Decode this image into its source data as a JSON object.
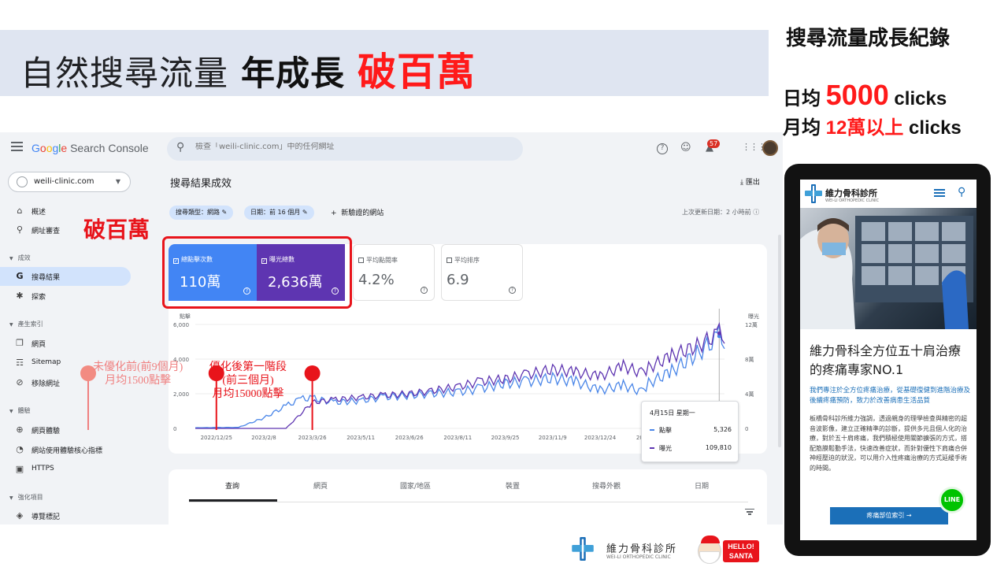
{
  "slide": {
    "title_part1": "自然搜尋流量",
    "title_part2": " 年成長 ",
    "title_part3": "破百萬",
    "side_title": "搜尋流量成長紀錄",
    "stat1_prefix": "日均 ",
    "stat1_value": "5000",
    "stat1_suffix": " clicks",
    "stat2_prefix": "月均 ",
    "stat2_value": "12萬以上",
    "stat2_suffix": " clicks",
    "accent_color": "#ff1a1a"
  },
  "gsc": {
    "app_name": "Google Search Console",
    "search_placeholder": "檢查「weili-clinic.com」中的任何網址",
    "notification_count": "57",
    "property": "weili-clinic.com",
    "nav": {
      "overview": "概述",
      "url_inspection": "網址審查",
      "section_performance": "成效",
      "search_results": "搜尋結果",
      "discover": "探索",
      "section_indexing": "產生索引",
      "pages": "網頁",
      "sitemaps": "Sitemap",
      "removals": "移除網址",
      "section_experience": "體驗",
      "page_experience": "網頁體驗",
      "core_web_vitals": "網站使用體驗核心指標",
      "https": "HTTPS",
      "section_enhancements": "強化項目",
      "breadcrumbs": "導覽標記"
    },
    "page_title": "搜尋結果成效",
    "export_label": "匯出",
    "filter_type": "搜尋類型：網路",
    "filter_date": "日期：前 16 個月",
    "add_comparison": "新驗證的網站",
    "last_updated": "上次更新日期：2 小時前",
    "metrics": [
      {
        "label": "總點擊次數",
        "value": "110萬",
        "checked": true
      },
      {
        "label": "曝光總數",
        "value": "2,636萬",
        "checked": true
      },
      {
        "label": "平均點閱率",
        "value": "4.2%",
        "checked": false
      },
      {
        "label": "平均排序",
        "value": "6.9",
        "checked": false
      }
    ],
    "callout_label": "破百萬",
    "tooltip": {
      "date": "4月15日 星期一",
      "clicks_label": "點擊",
      "clicks_value": "5,326",
      "impressions_label": "曝光",
      "impressions_value": "109,810"
    },
    "tabs": [
      "查詢",
      "網頁",
      "國家/地區",
      "裝置",
      "搜尋外觀",
      "日期"
    ]
  },
  "chart_data": {
    "type": "line",
    "left_axis_label": "點擊",
    "right_axis_label": "曝光",
    "left_ticks": [
      "6,000",
      "4,000",
      "2,000",
      "0"
    ],
    "right_ticks": [
      "12萬",
      "8萬",
      "4萬",
      "0"
    ],
    "ylim_left": [
      0,
      6000
    ],
    "ylim_right": [
      0,
      120000
    ],
    "x_ticks": [
      "2022/12/25",
      "2023/2/8",
      "2023/3/26",
      "2023/5/11",
      "2023/6/26",
      "2023/8/11",
      "2023/9/25",
      "2023/11/9",
      "2023/12/24",
      "2024/2/8",
      "2024/3/25"
    ],
    "x_range": [
      "2022/12/5",
      "2024/4/20"
    ],
    "series": [
      {
        "name": "點擊",
        "axis": "left",
        "color": "#4a86e8",
        "points": [
          [
            "2022/12/5",
            40
          ],
          [
            "2022/12/25",
            50
          ],
          [
            "2023/1/15",
            60
          ],
          [
            "2023/2/8",
            600
          ],
          [
            "2023/3/1",
            1300
          ],
          [
            "2023/3/15",
            1700
          ],
          [
            "2023/3/26",
            1750
          ],
          [
            "2023/4/15",
            1500
          ],
          [
            "2023/5/11",
            1600
          ],
          [
            "2023/6/1",
            1800
          ],
          [
            "2023/6/26",
            1900
          ],
          [
            "2023/7/15",
            2000
          ],
          [
            "2023/8/11",
            2100
          ],
          [
            "2023/9/1",
            2300
          ],
          [
            "2023/9/25",
            2600
          ],
          [
            "2023/10/15",
            2700
          ],
          [
            "2023/11/9",
            2900
          ],
          [
            "2023/12/1",
            2700
          ],
          [
            "2023/12/24",
            2200
          ],
          [
            "2024/1/15",
            2500
          ],
          [
            "2024/2/1",
            2100
          ],
          [
            "2024/2/8",
            2600
          ],
          [
            "2024/3/1",
            3300
          ],
          [
            "2024/3/25",
            4300
          ],
          [
            "2024/4/15",
            5326
          ],
          [
            "2024/4/20",
            4600
          ]
        ]
      },
      {
        "name": "曝光",
        "axis": "right",
        "color": "#5e35b1",
        "points": [
          [
            "2022/12/5",
            0
          ],
          [
            "2022/12/25",
            0
          ],
          [
            "2023/1/15",
            0
          ],
          [
            "2023/2/8",
            0
          ],
          [
            "2023/3/1",
            0
          ],
          [
            "2023/3/26",
            30000
          ],
          [
            "2023/4/15",
            33000
          ],
          [
            "2023/5/11",
            36000
          ],
          [
            "2023/6/1",
            38000
          ],
          [
            "2023/6/26",
            40000
          ],
          [
            "2023/7/15",
            43000
          ],
          [
            "2023/8/11",
            48000
          ],
          [
            "2023/9/1",
            54000
          ],
          [
            "2023/9/25",
            57000
          ],
          [
            "2023/10/15",
            62000
          ],
          [
            "2023/11/9",
            68000
          ],
          [
            "2023/12/1",
            65000
          ],
          [
            "2023/12/24",
            60000
          ],
          [
            "2024/1/15",
            72000
          ],
          [
            "2024/2/1",
            64000
          ],
          [
            "2024/2/8",
            70000
          ],
          [
            "2024/3/1",
            84000
          ],
          [
            "2024/3/25",
            95000
          ],
          [
            "2024/4/15",
            109810
          ],
          [
            "2024/4/20",
            98000
          ]
        ]
      }
    ]
  },
  "annotations": {
    "before_line1": "未優化前(前9個月)",
    "before_line2": "月均1500點擊",
    "after_line1": "優化後第一階段",
    "after_line2": "(前三個月)",
    "after_line3": "月均15000點擊",
    "before_date": "2022/12/20",
    "after_start_date": "2022/12/25",
    "after_end_date": "2023/3/26"
  },
  "phone": {
    "brand": "維力骨科診所",
    "brand_en": "WEI-LI ORTHOPEDIC CLINIC",
    "heading": "維力骨科全方位五十肩治療的疼痛專家NO.1",
    "sub": "我們專注於全方位疼痛治療，從基礎復健到進階治療及後續疼痛預防，致力於改善病患生活品質",
    "body": "板橋骨科診所維力強調，透過親身的理學檢查與精密的超音波影像，建立正確精準的診斷，提供多元且個人化的治療，對於五十肩疼痛，我們積極使用關節擴張的方式，搭配筋膜鬆動手法，快速改善症狀，而針對優性下肩痛合併神經壓迫的狀況，可以用介入性疼痛治療的方式延緩手術的時間。",
    "button": "疼痛部位索引 →",
    "line_label": "LINE",
    "brand_color": "#1b6fb8"
  },
  "footer": {
    "brand": "維力骨科診所",
    "brand_en": "WEI-LI ORTHOPEDIC CLINIC",
    "badge_line1": "HELLO!",
    "badge_line2": "SANTA"
  }
}
